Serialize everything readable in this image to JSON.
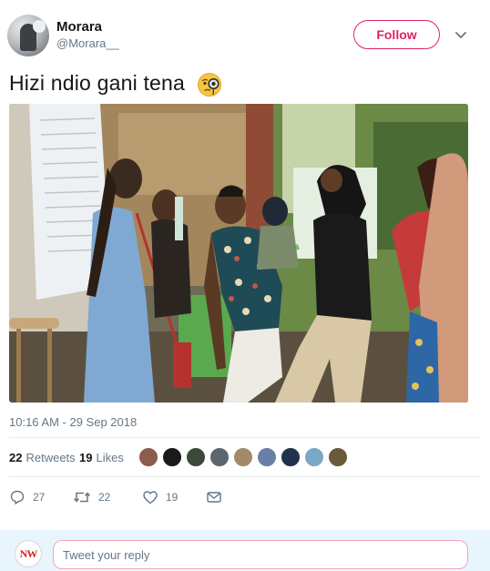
{
  "user": {
    "display_name": "Morara",
    "handle": "@Morara__"
  },
  "header": {
    "follow_label": "Follow",
    "menu_icon": "chevron-down-icon"
  },
  "tweet": {
    "text": "Hizi ndio gani tena",
    "emoji": "face-with-monocle-emoji",
    "timestamp": "10:16 AM - 29 Sep 2018",
    "photo_description_icon": "photo"
  },
  "stats": {
    "retweets_count": "22",
    "retweets_label": "Retweets",
    "likes_count": "19",
    "likes_label": "Likes"
  },
  "actions": {
    "reply_count": "27",
    "retweet_count": "22",
    "like_count": "19"
  },
  "reply": {
    "avatar_text": "NW",
    "placeholder": "Tweet your reply"
  },
  "colors": {
    "accent": "#e0245e",
    "muted": "#657786",
    "reply_bar_bg": "#e8f5fd"
  }
}
